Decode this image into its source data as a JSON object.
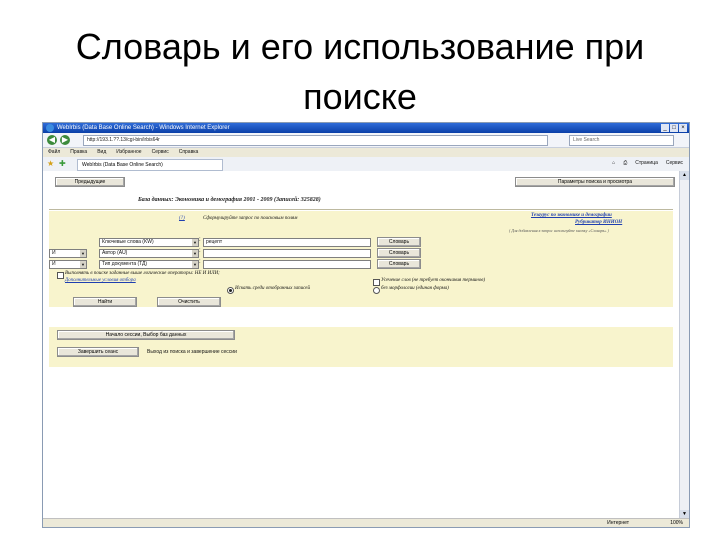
{
  "slide": {
    "title_line1": "Словарь и его использование при",
    "title_line2": "поиске"
  },
  "browser": {
    "title": "WebIrbis (Data Base Online Search) - Windows Internet Explorer",
    "url": "http://193.1.??.13/cgi-bin/irbis64r",
    "search_placeholder": "Live Search",
    "menu": [
      "Файл",
      "Правка",
      "Вид",
      "Избранное",
      "Сервис",
      "Справка"
    ],
    "tab_label": "WebIrbis (Data Base Online Search)",
    "command_items": [
      "Страница",
      "Сервис"
    ],
    "status_zone": "Интернет",
    "status_zoom": "100%"
  },
  "page": {
    "prev_button": "Предыдущие",
    "params_button": "Параметры поиска и просмотра",
    "db_line": "База данных: Экономика и демография 2001 - 2009 (Записей: 325828)",
    "help_link": "(?)",
    "compose_hint": "Сформулируйте запрос по поисковым полям",
    "right_link_line1": "Тезаурус по экономике и демографии",
    "right_link_line2": "Рубрикатор ИНИОН",
    "right_small_hint": "( Для добавления в запрос используйте кнопку «Словарь» )",
    "rows": [
      {
        "logic": "",
        "field": "Ключевые слова (KW)",
        "value": "рецепт",
        "button": "Словарь"
      },
      {
        "logic": "И",
        "field": "Автор (AU)",
        "value": "",
        "button": "Словарь"
      },
      {
        "logic": "И",
        "field": "Тип документа (ТД)",
        "value": "",
        "button": "Словарь"
      }
    ],
    "checkbox_label": "Выполнять в поиске заданные выше логические операторы: НЕ И ИЛИ;",
    "extra_conditions": "Дополнительные условия отбора",
    "search_button": "Найти",
    "clear_button": "Очистить",
    "search_current": "Искать среди отобранных записей",
    "opt_truncation": "Усечение слов (не требует окончания терминов)",
    "opt_no_morph": "без морфологии (единая форма)",
    "new_session_button": "Начало сессии, Выбор баз данных",
    "end_session_button": "Завершить сеанс",
    "end_session_text": "Выход из поиска и завершение сессии"
  },
  "colors": {
    "beige": "#f8f4cd",
    "link": "#1f3fb0",
    "titlebar": "#0a3fa8"
  }
}
